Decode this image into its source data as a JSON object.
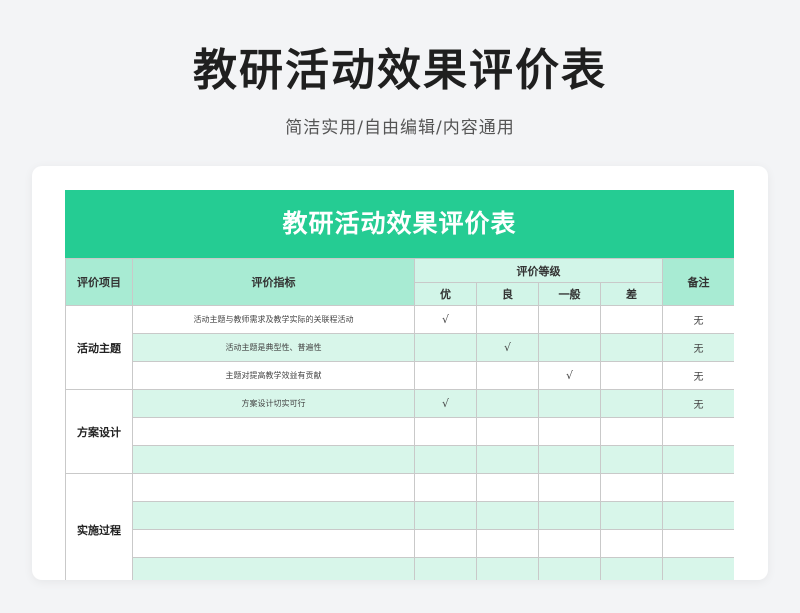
{
  "header": {
    "title": "教研活动效果评价表",
    "subtitle": "简洁实用/自由编辑/内容通用"
  },
  "sheet": {
    "title": "教研活动效果评价表",
    "columns": {
      "item": "评价项目",
      "indicator": "评价指标",
      "grade": "评价等级",
      "grades": [
        "优",
        "良",
        "一般",
        "差"
      ],
      "note": "备注"
    },
    "groups": [
      {
        "name": "活动主题",
        "rows": [
          {
            "indicator": "活动主题与教师需求及教学实际的关联程活动",
            "marks": [
              "√",
              "",
              "",
              ""
            ],
            "note": "无"
          },
          {
            "indicator": "活动主题是典型性、普遍性",
            "marks": [
              "",
              "√",
              "",
              ""
            ],
            "note": "无"
          },
          {
            "indicator": "主题对提高教学效益有贡献",
            "marks": [
              "",
              "",
              "√",
              ""
            ],
            "note": "无"
          }
        ]
      },
      {
        "name": "方案设计",
        "rows": [
          {
            "indicator": "方案设计切实可行",
            "marks": [
              "√",
              "",
              "",
              ""
            ],
            "note": "无"
          },
          {
            "indicator": "",
            "marks": [
              "",
              "",
              "",
              ""
            ],
            "note": ""
          },
          {
            "indicator": "",
            "marks": [
              "",
              "",
              "",
              ""
            ],
            "note": ""
          }
        ]
      },
      {
        "name": "实施过程",
        "rows": [
          {
            "indicator": "",
            "marks": [
              "",
              "",
              "",
              ""
            ],
            "note": ""
          },
          {
            "indicator": "",
            "marks": [
              "",
              "",
              "",
              ""
            ],
            "note": ""
          },
          {
            "indicator": "",
            "marks": [
              "",
              "",
              "",
              ""
            ],
            "note": ""
          },
          {
            "indicator": "",
            "marks": [
              "",
              "",
              "",
              ""
            ],
            "note": ""
          }
        ]
      }
    ]
  },
  "colors": {
    "title_bar": "#25cc93",
    "header_bg": "#a8ebd3",
    "stripe": "#d8f6ea"
  }
}
